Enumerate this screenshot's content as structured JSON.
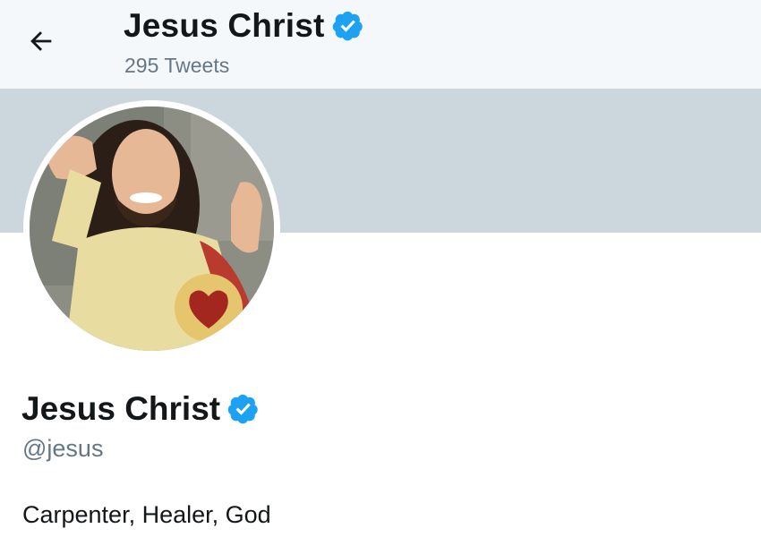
{
  "header": {
    "name": "Jesus Christ",
    "tweet_count": "295 Tweets",
    "back_icon": "arrow-left-icon",
    "verified_icon": "verified-badge-icon"
  },
  "profile": {
    "name": "Jesus Christ",
    "handle": "@jesus",
    "bio": "Carpenter, Healer, God",
    "avatar_subject": "Buddy Christ statue giving thumbs up"
  },
  "colors": {
    "header_bg": "#f5f8fa",
    "banner_bg": "#ccd6dd",
    "verified": "#1da1f2",
    "secondary_text": "#657786",
    "primary_text": "#14171a"
  }
}
